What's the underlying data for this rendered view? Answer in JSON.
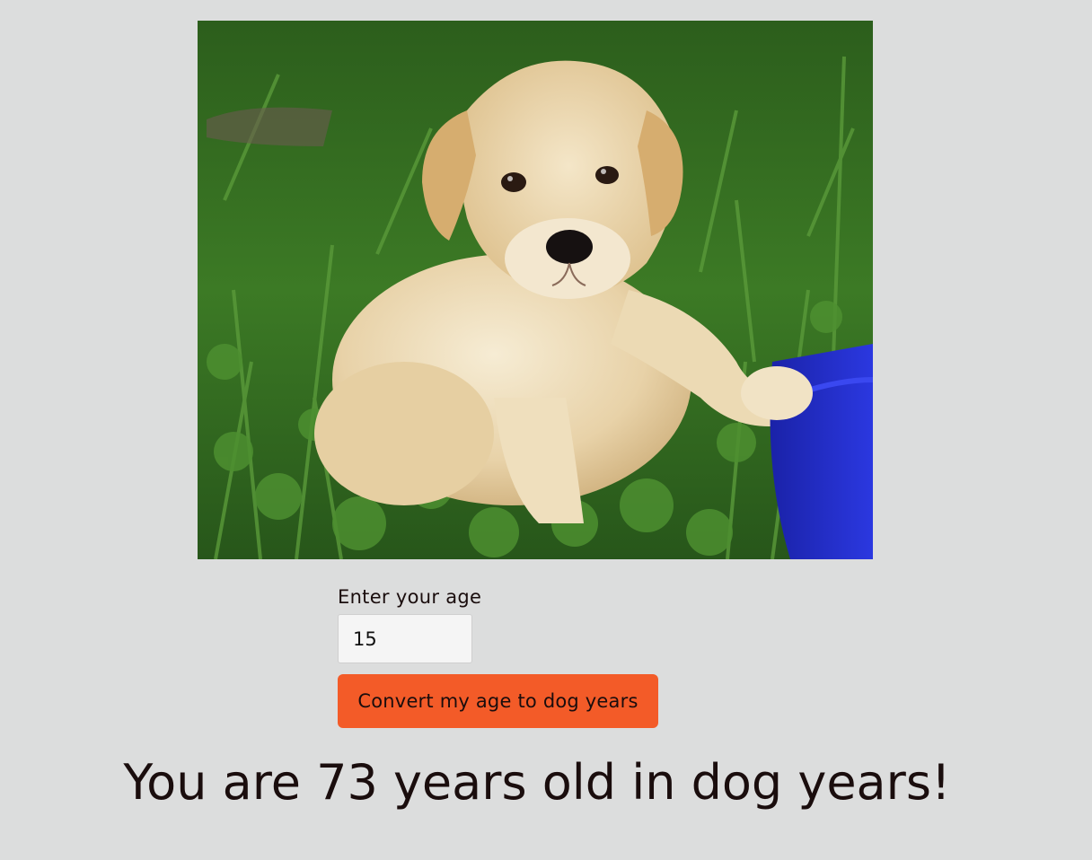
{
  "form": {
    "label": "Enter your age",
    "age_value": "15",
    "button_label": "Convert my age to dog years"
  },
  "result": {
    "text": "You are 73 years old in dog years!"
  },
  "colors": {
    "background": "#dcdddd",
    "button": "#f35b28",
    "text": "#1a0d0d"
  }
}
